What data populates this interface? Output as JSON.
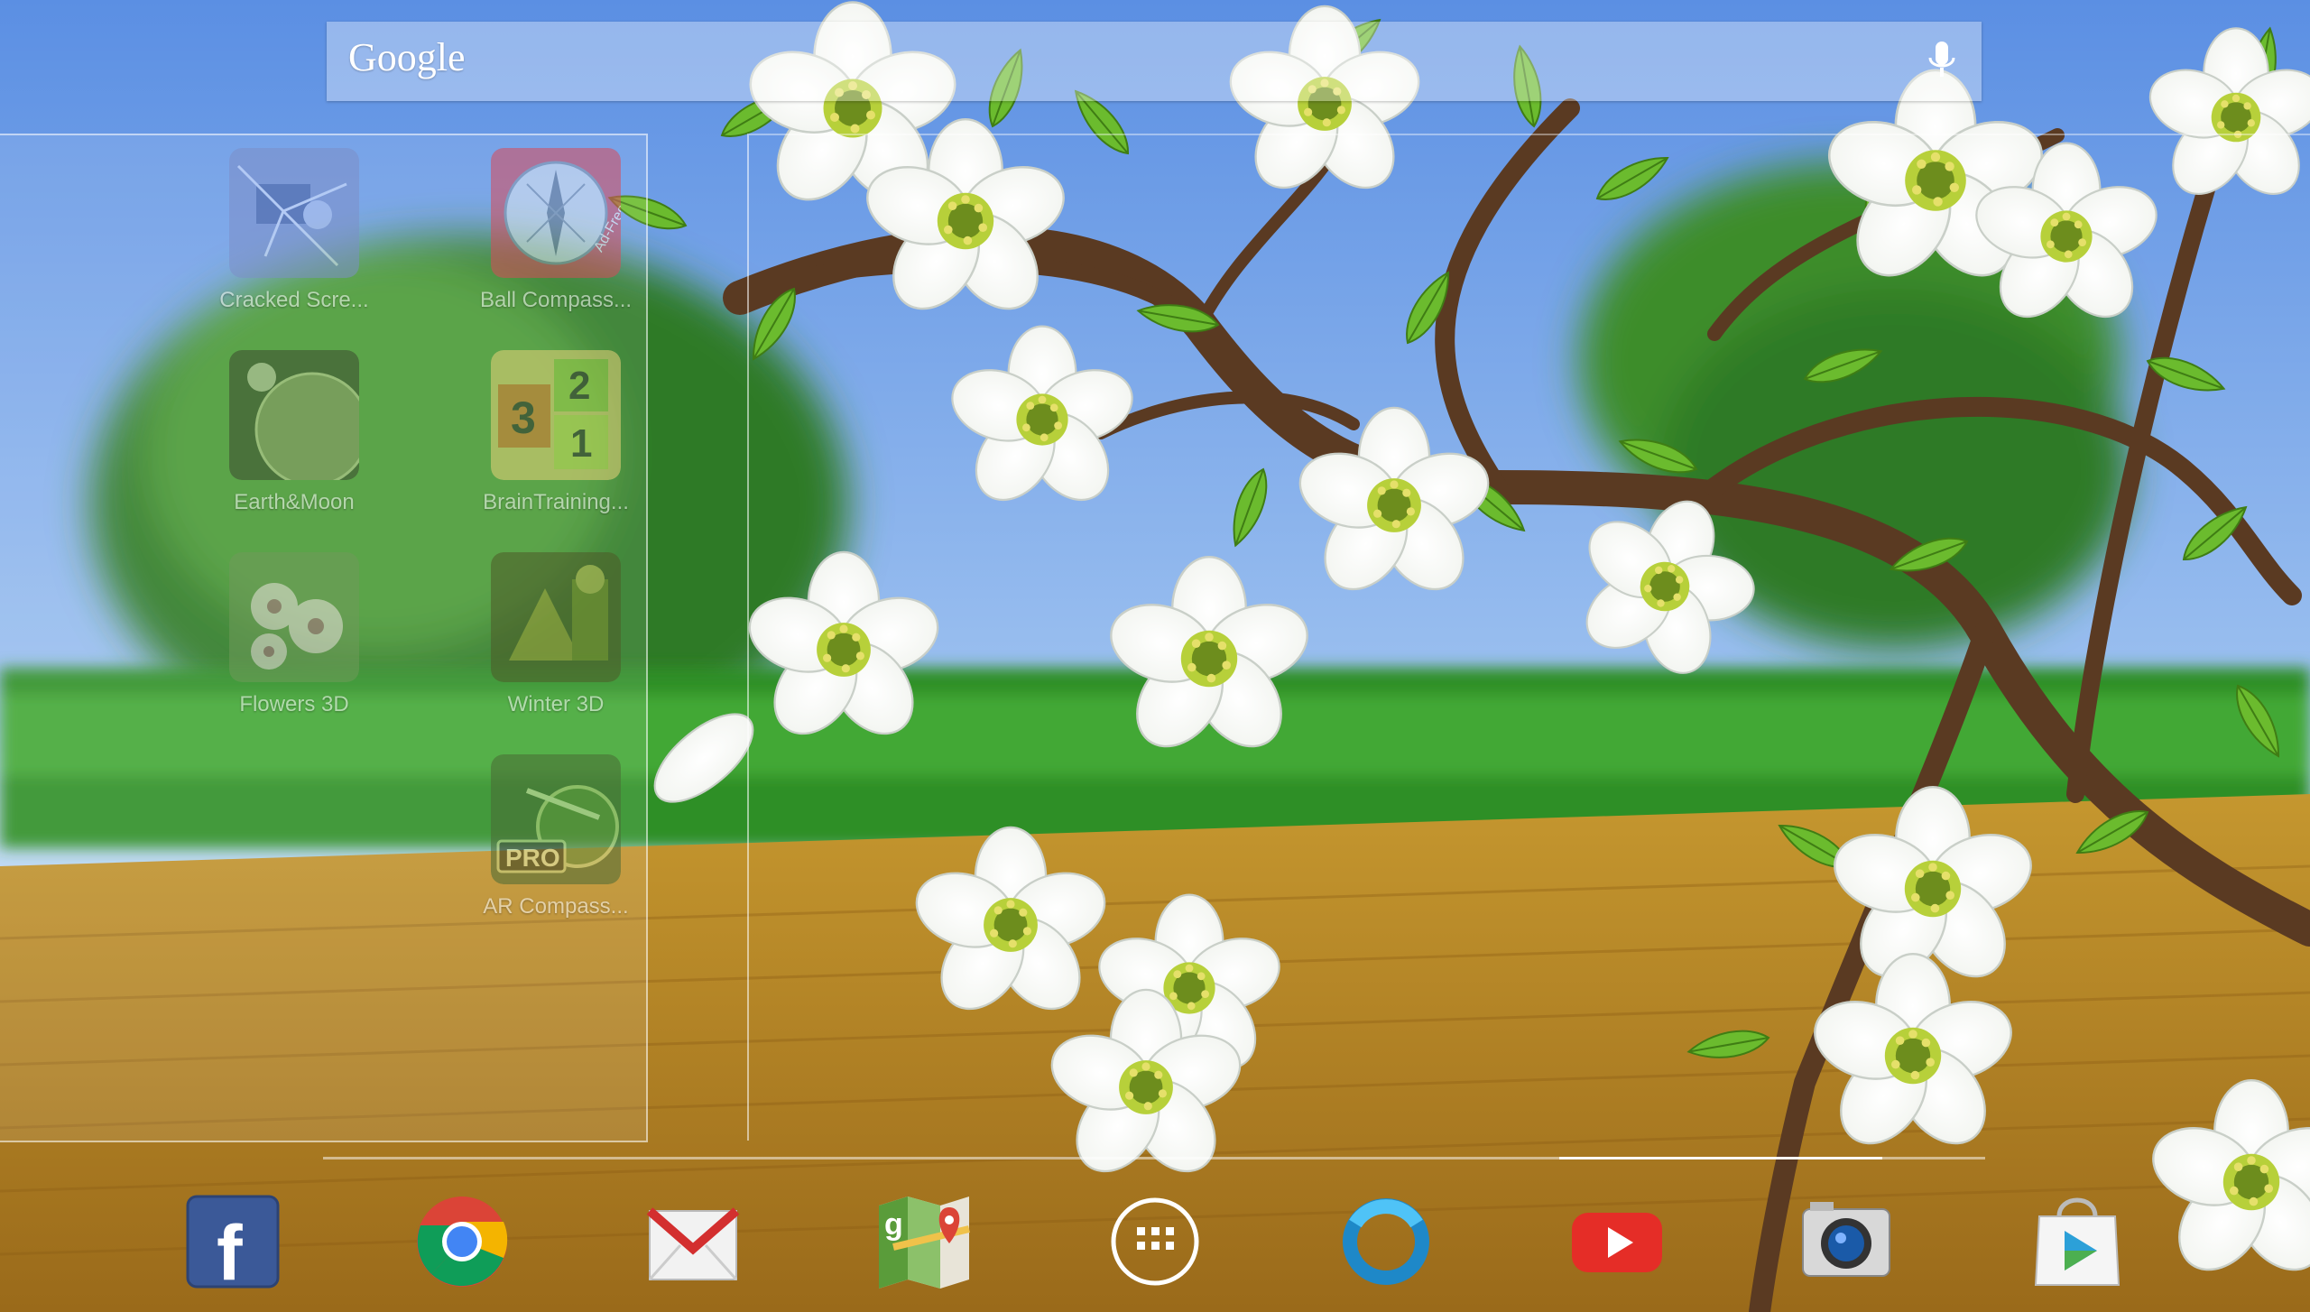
{
  "search": {
    "logo_text": "Google",
    "mic_icon": "microphone-icon"
  },
  "folder_apps": [
    {
      "label": "Cracked Scre...",
      "icon": "cracked-screen-icon"
    },
    {
      "label": "Ball Compass...",
      "icon": "ball-compass-icon",
      "badge": "Ad-Free"
    },
    {
      "label": "Earth&Moon",
      "icon": "earth-moon-icon"
    },
    {
      "label": "BrainTraining...",
      "icon": "brain-training-icon",
      "digits": [
        "3",
        "2",
        "1"
      ]
    },
    {
      "label": "Flowers 3D",
      "icon": "flowers-3d-icon"
    },
    {
      "label": "Winter 3D",
      "icon": "winter-3d-icon"
    },
    {
      "label": "AR Compass...",
      "icon": "ar-compass-icon",
      "badge": "PRO"
    }
  ],
  "dock": [
    {
      "name": "facebook",
      "icon": "facebook-icon",
      "glyph": "f"
    },
    {
      "name": "chrome",
      "icon": "chrome-icon"
    },
    {
      "name": "gmail",
      "icon": "gmail-icon",
      "glyph": "M"
    },
    {
      "name": "maps",
      "icon": "maps-icon",
      "glyph": "g"
    },
    {
      "name": "all-apps",
      "icon": "app-drawer-icon"
    },
    {
      "name": "circle-app",
      "icon": "ring-app-icon"
    },
    {
      "name": "youtube",
      "icon": "youtube-icon"
    },
    {
      "name": "camera",
      "icon": "camera-icon"
    },
    {
      "name": "play-store",
      "icon": "play-store-icon"
    }
  ],
  "colors": {
    "sky": "#6fa0e8",
    "grass": "#2f8f2a",
    "field": "#b88a2a",
    "facebook": "#3b5998",
    "youtube": "#e52d27"
  }
}
